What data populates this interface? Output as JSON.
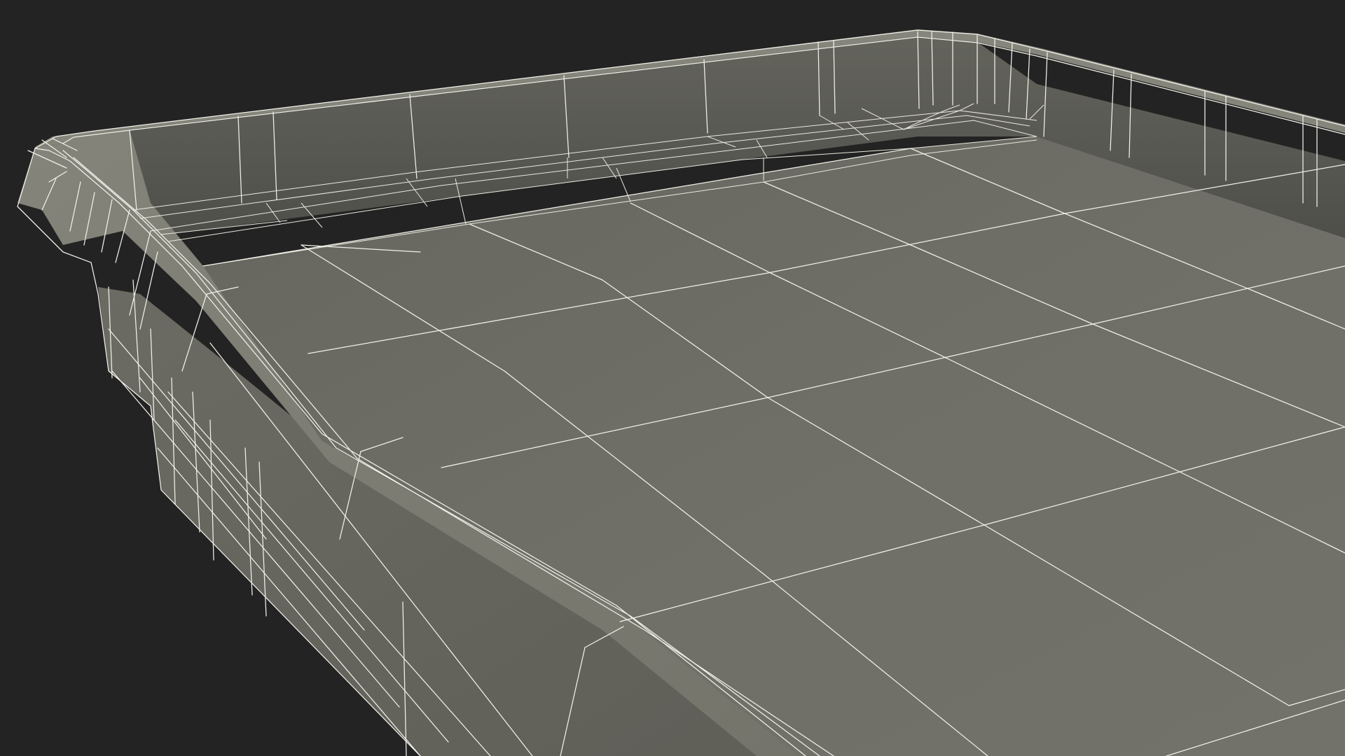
{
  "scene": {
    "subject": "",
    "background_color": "#232323",
    "surface_color": "#6f6f66",
    "rim_color": "#7a7a70",
    "inner_wall_color": "#595953",
    "wireframe_color": "#f1f1ea"
  }
}
